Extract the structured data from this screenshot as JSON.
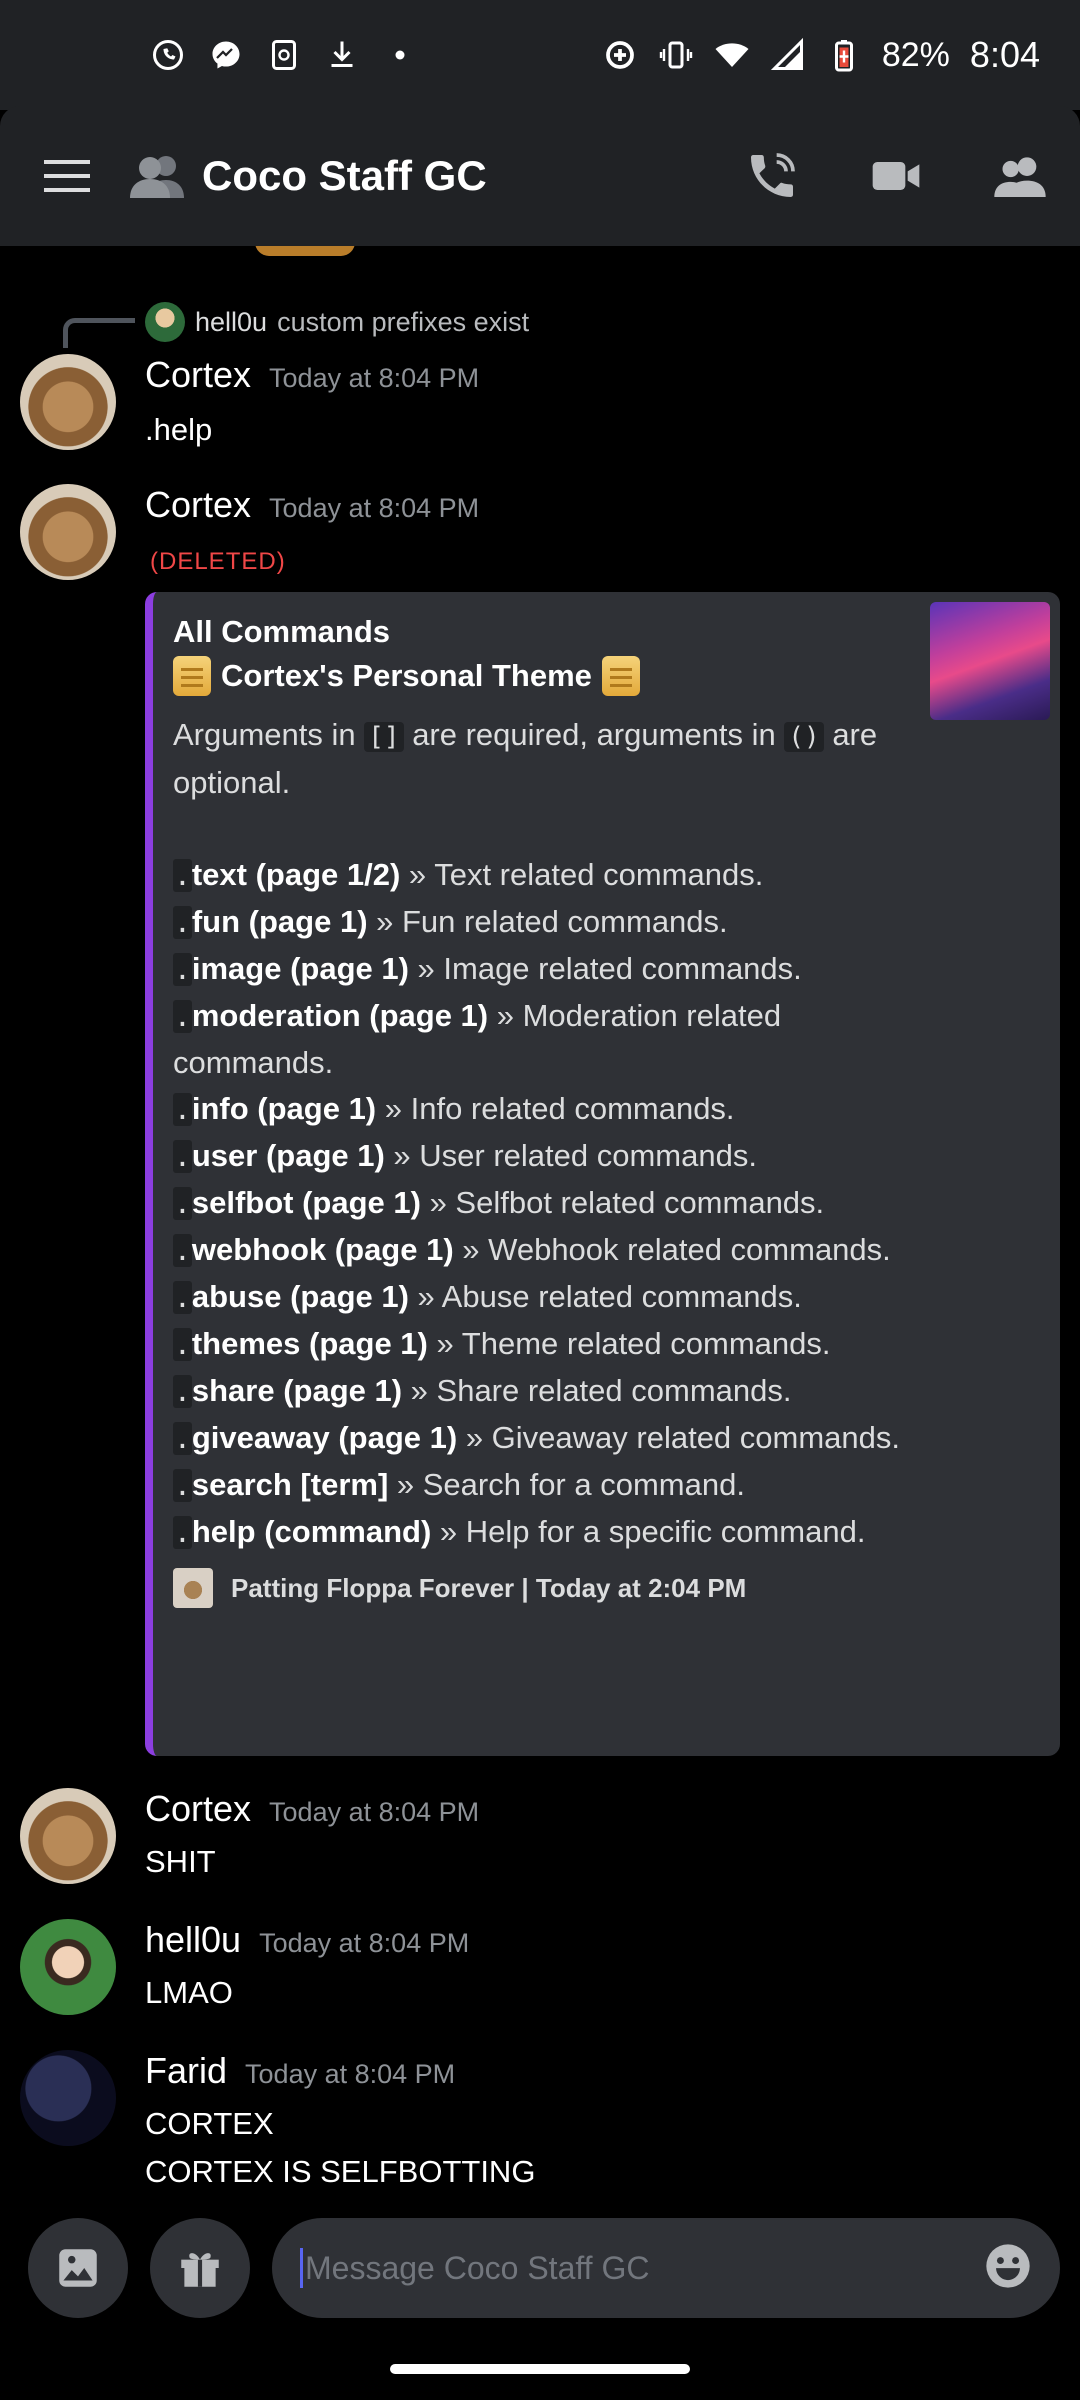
{
  "status_bar": {
    "icons": [
      "whatsapp-icon",
      "messenger-icon",
      "sync-icon",
      "download-icon",
      "dot-icon",
      "data-saver-icon",
      "vibrate-icon",
      "wifi-icon",
      "signal-icon",
      "battery-icon"
    ],
    "battery": "82%",
    "time": "8:04"
  },
  "header": {
    "title": "Coco Staff GC",
    "actions": [
      "call-icon",
      "video-icon",
      "members-icon"
    ]
  },
  "reply": {
    "username": "hell0u",
    "text": "custom prefixes exist"
  },
  "messages": [
    {
      "username": "Cortex",
      "timestamp": "Today at 8:04 PM",
      "lines": [
        ".help"
      ]
    },
    {
      "username": "Cortex",
      "timestamp": "Today at 8:04 PM",
      "tag": "(DELETED)"
    },
    {
      "username": "Cortex",
      "timestamp": "Today at 8:04 PM",
      "lines": [
        "SHIT"
      ]
    },
    {
      "username": "hell0u",
      "timestamp": "Today at 8:04 PM",
      "lines": [
        "LMAO"
      ]
    },
    {
      "username": "Farid",
      "timestamp": "Today at 8:04 PM",
      "lines": [
        "CORTEX",
        "CORTEX IS SELFBOTTING"
      ]
    }
  ],
  "embed": {
    "author": "All Commands",
    "title": "Cortex's Personal Theme",
    "desc_a": "Arguments in ",
    "desc_code1": "[]",
    "desc_b": " are required, arguments in ",
    "desc_code2": "()",
    "desc_c": " are optional.",
    "commands": [
      {
        "name": "text (page 1/2)",
        "desc": " » Text related commands."
      },
      {
        "name": "fun (page 1)",
        "desc": " » Fun related commands."
      },
      {
        "name": "image (page 1)",
        "desc": " » Image related commands."
      },
      {
        "name": "moderation (page 1)",
        "desc": " » Moderation related commands."
      },
      {
        "name": "info (page 1)",
        "desc": " » Info related commands."
      },
      {
        "name": "user (page 1)",
        "desc": " » User related commands."
      },
      {
        "name": "selfbot (page 1)",
        "desc": " » Selfbot related commands."
      },
      {
        "name": "webhook (page 1)",
        "desc": " » Webhook related commands."
      },
      {
        "name": "abuse (page 1)",
        "desc": " » Abuse related commands."
      },
      {
        "name": "themes (page 1)",
        "desc": " » Theme related commands."
      },
      {
        "name": "share (page 1)",
        "desc": " » Share related commands."
      },
      {
        "name": "giveaway (page 1)",
        "desc": " » Giveaway related commands."
      }
    ],
    "extra_commands": [
      {
        "name": "search [term]",
        "desc": " » Search for a command."
      },
      {
        "name": "help (command)",
        "desc": " » Help for a specific command."
      }
    ],
    "footer": "Patting Floppa Forever | Today at 2:04 PM"
  },
  "input": {
    "placeholder": "Message Coco Staff GC"
  }
}
